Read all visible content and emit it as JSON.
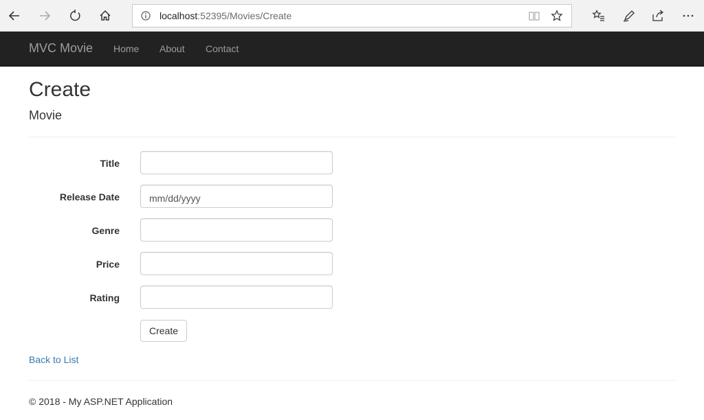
{
  "browser": {
    "url_host": "localhost",
    "url_rest": ":52395/Movies/Create"
  },
  "navbar": {
    "brand": "MVC Movie",
    "links": [
      "Home",
      "About",
      "Contact"
    ]
  },
  "page": {
    "title": "Create",
    "subtitle": "Movie"
  },
  "form": {
    "fields": [
      {
        "label": "Title",
        "value": "",
        "placeholder": ""
      },
      {
        "label": "Release Date",
        "value": "",
        "placeholder": "mm/dd/yyyy"
      },
      {
        "label": "Genre",
        "value": "",
        "placeholder": ""
      },
      {
        "label": "Price",
        "value": "",
        "placeholder": ""
      },
      {
        "label": "Rating",
        "value": "",
        "placeholder": ""
      }
    ],
    "submit_label": "Create"
  },
  "back_link": "Back to List",
  "footer": "© 2018 - My ASP.NET Application"
}
